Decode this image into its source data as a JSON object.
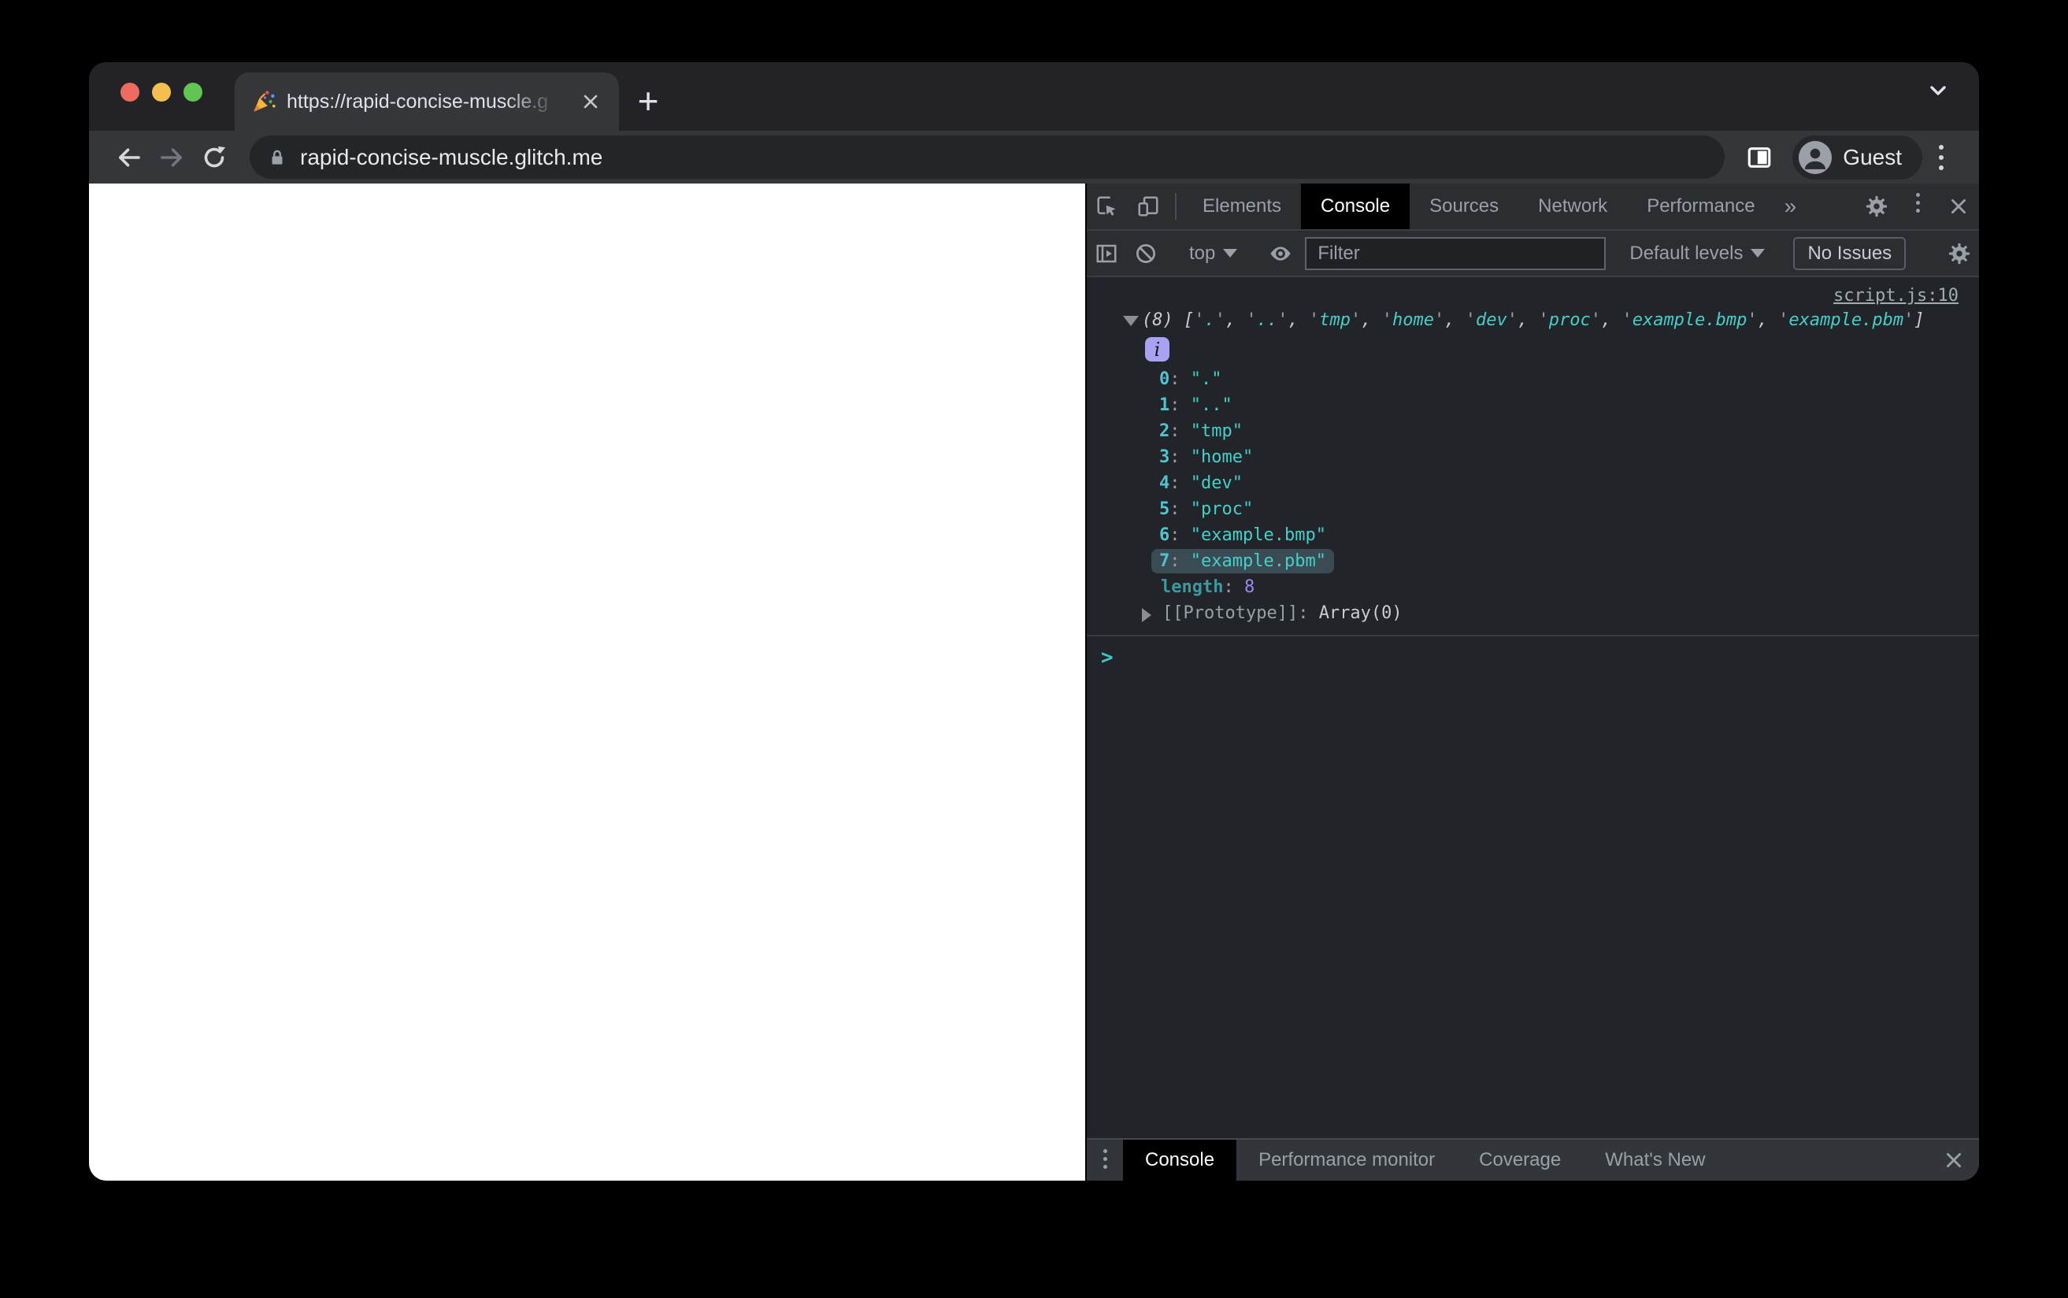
{
  "browser": {
    "tab_title": "https://rapid-concise-muscle.g",
    "tab_favicon": "party-popper",
    "new_tab_label": "+",
    "url": "rapid-concise-muscle.glitch.me",
    "profile_label": "Guest"
  },
  "devtools": {
    "tabs": [
      "Elements",
      "Console",
      "Sources",
      "Network",
      "Performance"
    ],
    "active_tab": "Console",
    "more_tabs_label": "»",
    "toolbar": {
      "context_label": "top",
      "filter_placeholder": "Filter",
      "levels_label": "Default levels",
      "issues_label": "No Issues"
    },
    "console": {
      "source_link": "script.js:10",
      "summary_prefix": "(8)",
      "items": [
        ".",
        "..",
        "tmp",
        "home",
        "dev",
        "proc",
        "example.bmp",
        "example.pbm"
      ],
      "highlighted_index": 7,
      "info_badge_label": "i",
      "length_label": "length",
      "length_value": "8",
      "prototype_label": "[[Prototype]]",
      "prototype_value": "Array(0)",
      "prompt_symbol": ">"
    },
    "drawer": {
      "tabs": [
        "Console",
        "Performance monitor",
        "Coverage",
        "What's New"
      ],
      "active_tab": "Console"
    }
  },
  "colors": {
    "string_teal": "#46CFC9",
    "index_teal": "#53C4CF",
    "number_purple": "#9B87F5",
    "info_badge_lavender": "#A9A2F2",
    "highlighted_row_bg": "#3A4B54",
    "active_tab_bg": "#000000",
    "traffic_red": "#EC6A5E",
    "traffic_yellow": "#F5BF4F",
    "traffic_green": "#61C554"
  }
}
